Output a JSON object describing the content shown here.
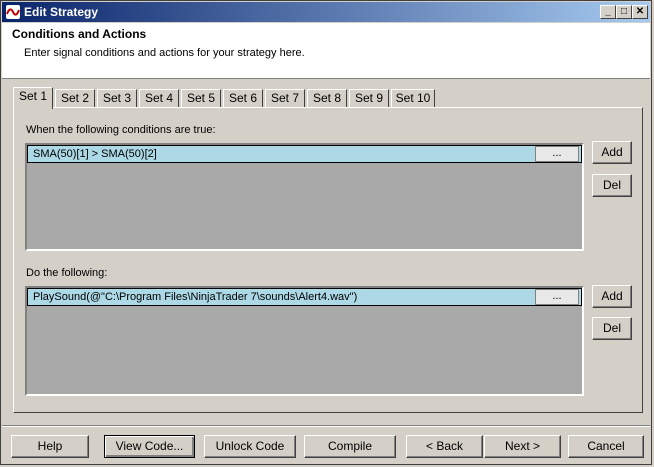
{
  "window": {
    "title": "Edit Strategy",
    "controls": {
      "minimize": "_",
      "maximize": "□",
      "close": "✕"
    }
  },
  "header": {
    "title": "Conditions and Actions",
    "subtitle": "Enter signal conditions and actions for your strategy here."
  },
  "tabs": [
    "Set 1",
    "Set 2",
    "Set 3",
    "Set 4",
    "Set 5",
    "Set 6",
    "Set 7",
    "Set 8",
    "Set 9",
    "Set 10"
  ],
  "active_tab": "Set 1",
  "conditions": {
    "label": "When the following conditions are true:",
    "items": [
      "SMA(50)[1] > SMA(50)[2]"
    ],
    "ellipsis": "...",
    "add_label": "Add",
    "del_label": "Del"
  },
  "actions": {
    "label": "Do the following:",
    "items": [
      "PlaySound(@\"C:\\Program Files\\NinjaTrader 7\\sounds\\Alert4.wav\")"
    ],
    "ellipsis": "...",
    "add_label": "Add",
    "del_label": "Del"
  },
  "footer": {
    "help": "Help",
    "view_code": "View Code...",
    "unlock_code": "Unlock Code",
    "compile": "Compile",
    "back": "< Back",
    "next": "Next >",
    "cancel": "Cancel"
  }
}
